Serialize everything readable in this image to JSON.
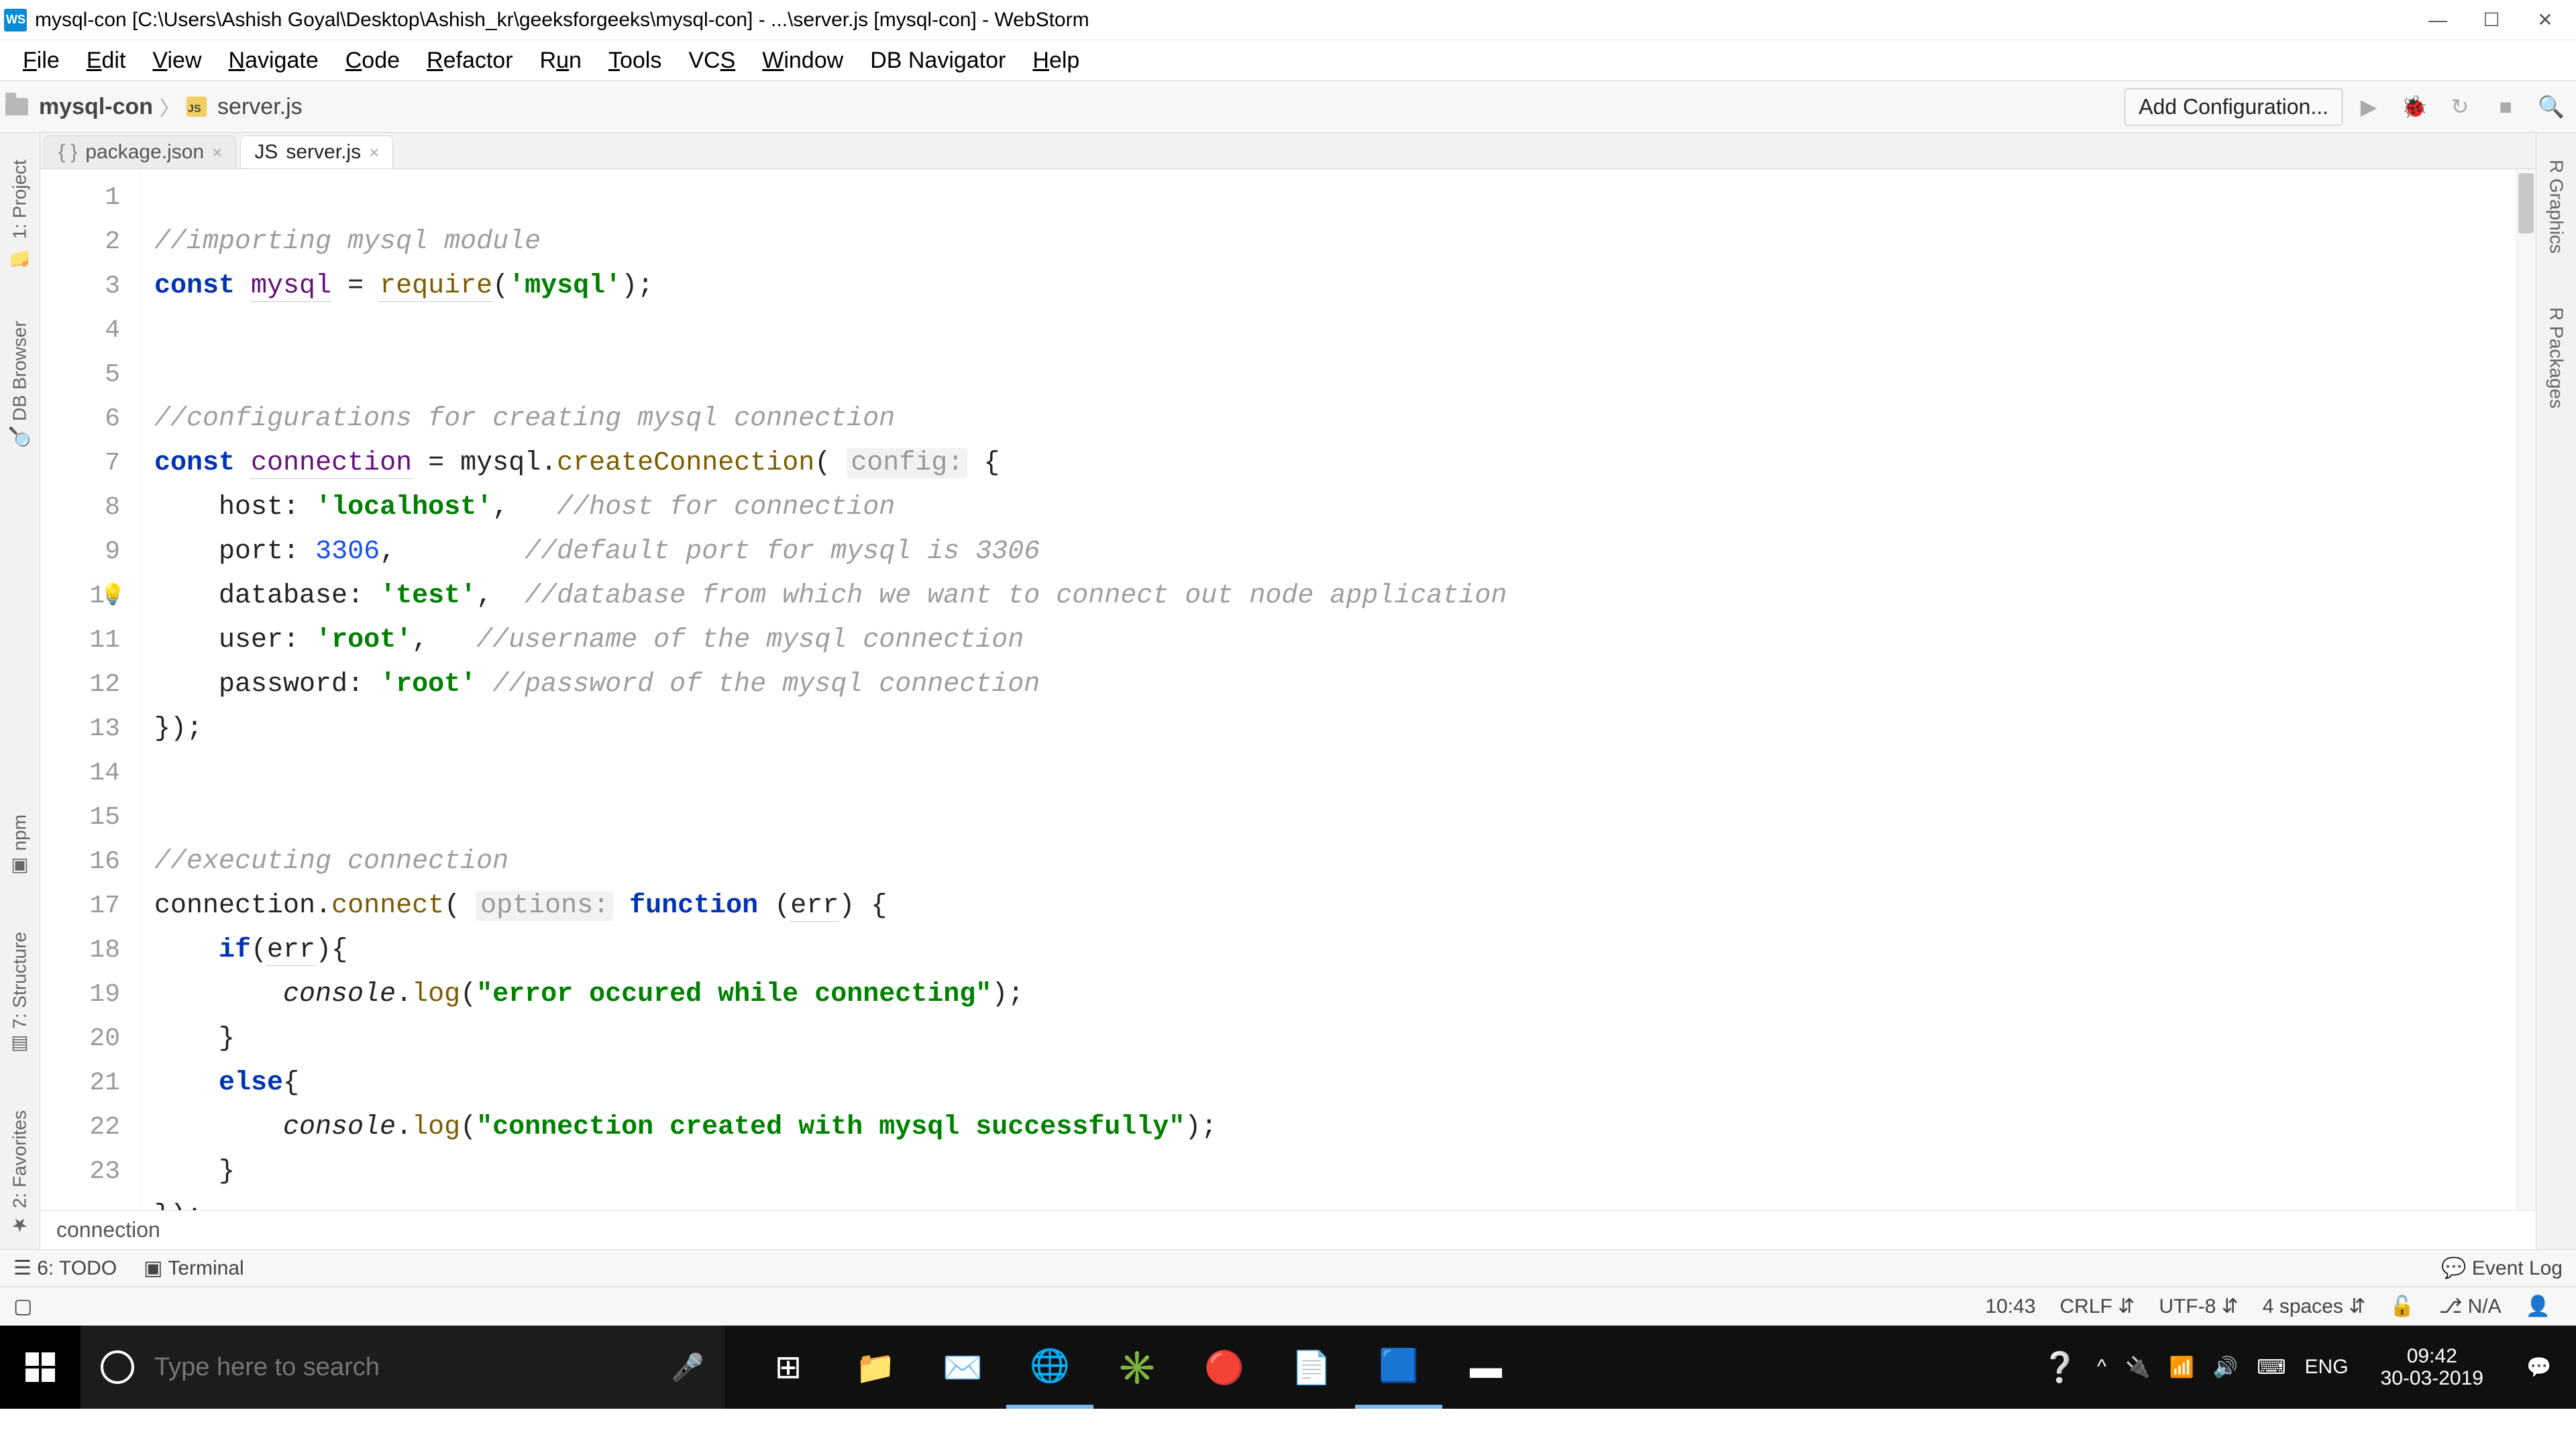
{
  "title": "mysql-con [C:\\Users\\Ashish Goyal\\Desktop\\Ashish_kr\\geeksforgeeks\\mysql-con] - ...\\server.js [mysql-con] - WebStorm",
  "menu": {
    "items": [
      "File",
      "Edit",
      "View",
      "Navigate",
      "Code",
      "Refactor",
      "Run",
      "Tools",
      "VCS",
      "Window",
      "DB Navigator",
      "Help"
    ]
  },
  "breadcrumb": {
    "project": "mysql-con",
    "file": "server.js"
  },
  "toolbar": {
    "add_config": "Add Configuration..."
  },
  "tabs": [
    {
      "name": "package.json",
      "active": false
    },
    {
      "name": "server.js",
      "active": true
    }
  ],
  "line_numbers": [
    "1",
    "2",
    "3",
    "4",
    "5",
    "6",
    "7",
    "8",
    "9",
    "10",
    "11",
    "12",
    "13",
    "14",
    "15",
    "16",
    "17",
    "18",
    "19",
    "20",
    "21",
    "22",
    "23"
  ],
  "highlight_line_index": 9,
  "code": {
    "l1_comment": "//importing mysql module",
    "l2_kw": "const",
    "l2_var": "mysql",
    "l2_eq": " = ",
    "l2_fn": "require",
    "l2_open": "(",
    "l2_str": "'mysql'",
    "l2_close": ");",
    "l5_comment": "//configurations for creating mysql connection",
    "l6_kw": "const",
    "l6_var": "connection",
    "l6_eq": " = ",
    "l6_obj": "mysql",
    "l6_dot": ".",
    "l6_fn": "createConnection",
    "l6_open": "( ",
    "l6_hint": "config:",
    "l6_brace": " {",
    "l7_key": "host:",
    "l7_val": "'localhost'",
    "l7_comma": ",",
    "l7_comment": "//host for connection",
    "l8_key": "port:",
    "l8_val": "3306",
    "l8_comma": ",",
    "l8_comment": "//default port for mysql is 3306",
    "l9_key": "database:",
    "l9_val": "'test'",
    "l9_comma": ",",
    "l9_comment": "//database from which we want to connect out node application",
    "l10_key": "user:",
    "l10_val": "'root'",
    "l10_comma": ",",
    "l10_comment": "//username of the mysql connection",
    "l11_key": "password:",
    "l11_val": "'root'",
    "l11_comment": "//password of the mysql connection",
    "l12": "});",
    "l15_comment": "//executing connection",
    "l16_obj": "connection",
    "l16_dot": ".",
    "l16_fn": "connect",
    "l16_open": "( ",
    "l16_hint": "options:",
    "l16_kw": " function ",
    "l16_p1": "(",
    "l16_err": "err",
    "l16_p2": ") {",
    "l17_kw": "if",
    "l17_open": "(",
    "l17_err": "err",
    "l17_close": "){",
    "l18_obj": "console",
    "l18_dot": ".",
    "l18_fn": "log",
    "l18_open": "(",
    "l18_str": "\"error occured while connecting\"",
    "l18_close": ");",
    "l19": "}",
    "l20_kw": "else",
    "l20_open": "{",
    "l21_obj": "console",
    "l21_dot": ".",
    "l21_fn": "log",
    "l21_open": "(",
    "l21_str": "\"connection created with mysql successfully\"",
    "l21_close": ");",
    "l22": "}",
    "l23": "});"
  },
  "breadcrumb2": "connection",
  "left_tabs": [
    "1: Project",
    "DB Browser",
    "npm",
    "7: Structure",
    "2: Favorites"
  ],
  "right_tabs": [
    "R Graphics",
    "R Packages"
  ],
  "bottom_tools": {
    "todo": "6: TODO",
    "terminal": "Terminal",
    "event_log": "Event Log"
  },
  "status": {
    "time": "10:43",
    "crlf": "CRLF",
    "enc": "UTF-8",
    "indent": "4 spaces",
    "git": "N/A"
  },
  "taskbar": {
    "search_placeholder": "Type here to search",
    "lang": "ENG",
    "clock_time": "09:42",
    "clock_date": "30-03-2019"
  }
}
